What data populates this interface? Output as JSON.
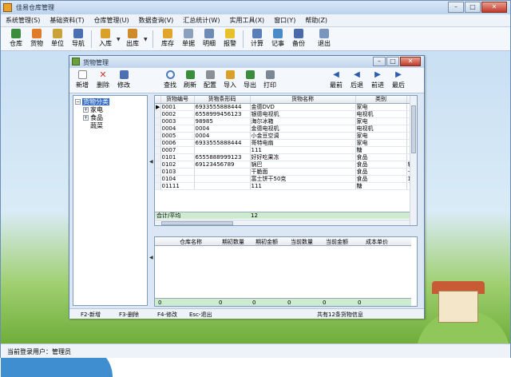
{
  "app": {
    "title": "佳易仓库管理"
  },
  "menu": [
    "系统管理(S)",
    "基础资料(T)",
    "仓库管理(U)",
    "数据查询(V)",
    "汇总统计(W)",
    "实用工具(X)",
    "窗口(Y)",
    "帮助(Z)"
  ],
  "toolbar": [
    "仓库",
    "货物",
    "单位",
    "导航",
    "入库",
    "出库",
    "库存",
    "单据",
    "明细",
    "报警",
    "计算",
    "记事",
    "备份",
    "退出"
  ],
  "window": {
    "title": "货物管理",
    "toolbar_left": [
      "新增",
      "删除",
      "修改"
    ],
    "toolbar_mid": [
      "查找",
      "刷新",
      "配置",
      "导入",
      "导出",
      "打印"
    ],
    "toolbar_right": [
      "最前",
      "后退",
      "前进",
      "最后"
    ],
    "tree": {
      "root": "货物分类",
      "children": [
        "家电",
        "食品",
        "蔬菜"
      ]
    },
    "grid": {
      "columns": [
        "货物编号",
        "货物条形码",
        "货物名称",
        "类别"
      ],
      "rows": [
        [
          "0001",
          "6933555888444",
          "金德DVD",
          "家电"
        ],
        [
          "0002",
          "6558999456123",
          "银德电视机",
          "电视机"
        ],
        [
          "0003",
          "98985",
          "海尔冰箱",
          "家电"
        ],
        [
          "0004",
          "0004",
          "金德电视机",
          "电视机"
        ],
        [
          "0005",
          "0004",
          "小金豆空调",
          "家电"
        ],
        [
          "0006",
          "6933555888444",
          "哥特电扇",
          "家电"
        ],
        [
          "0007",
          "",
          "111",
          "糖"
        ],
        [
          "0101",
          "6555888999123",
          "好好吃果冻",
          "食品"
        ],
        [
          "0102",
          "69123456789",
          "锅巴",
          "食品"
        ],
        [
          "0103",
          "",
          "干脆面",
          "食品"
        ],
        [
          "0104",
          "",
          "富士饼干50克",
          "食品"
        ],
        [
          "01111",
          "",
          "111",
          "糖"
        ]
      ],
      "extra_col": [
        "",
        "",
        "",
        "",
        "",
        "",
        "",
        "",
        "轴",
        "卡",
        "1",
        ""
      ],
      "sum_label": "合计/平均",
      "sum_value": "12"
    },
    "grid2": {
      "columns": [
        "仓库名称",
        "期初数量",
        "期初金额",
        "当前数量",
        "当前金额",
        "成本单价"
      ],
      "sums": [
        "0",
        "0",
        "0",
        "0",
        "0",
        "0"
      ]
    },
    "status": [
      "F2-新增",
      "F3-删除",
      "F4-修改",
      "Esc-退出",
      "共有12条货物信息"
    ]
  },
  "statusbar": "当前登录用户：管理员",
  "colors": {
    "selection": "#3169c6",
    "sum_row": "#cdeccf",
    "titlebar": "#c2d6ee"
  }
}
